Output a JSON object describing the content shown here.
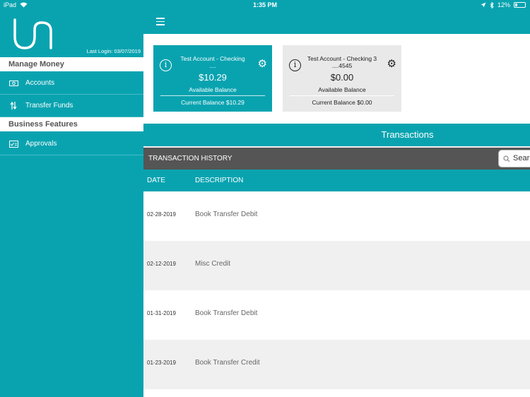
{
  "status_bar": {
    "device": "iPad",
    "time": "1:35 PM",
    "battery": "12%"
  },
  "sidebar": {
    "last_login": "Last Login:  03/07/2019",
    "sections": [
      {
        "title": "Manage Money",
        "items": [
          {
            "label": "Accounts",
            "icon": "accounts-icon"
          },
          {
            "label": "Transfer Funds",
            "icon": "transfer-icon"
          }
        ]
      },
      {
        "title": "Business Features",
        "items": [
          {
            "label": "Approvals",
            "icon": "approvals-icon"
          }
        ]
      }
    ]
  },
  "accounts": [
    {
      "name": "Test Account - Checking",
      "number": "....",
      "balance": "$10.29",
      "balance_label": "Available Balance",
      "current": "Current Balance $10.29"
    },
    {
      "name": "Test Account - Checking 3",
      "number": "....4545",
      "balance": "$0.00",
      "balance_label": "Available Balance",
      "current": "Current Balance $0.00"
    }
  ],
  "transactions": {
    "title": "Transactions",
    "history_label": "TRANSACTION HISTORY",
    "search_placeholder": "Sear",
    "columns": {
      "date": "DATE",
      "description": "DESCRIPTION"
    },
    "rows": [
      {
        "date": "02-28-2019",
        "description": "Book Transfer Debit"
      },
      {
        "date": "02-12-2019",
        "description": "Misc Credit"
      },
      {
        "date": "01-31-2019",
        "description": "Book Transfer Debit"
      },
      {
        "date": "01-23-2019",
        "description": "Book Transfer Credit"
      }
    ]
  },
  "colors": {
    "brand": "#09a3b0",
    "dark_bar": "#555555",
    "row_alt": "#f0f0f0"
  }
}
